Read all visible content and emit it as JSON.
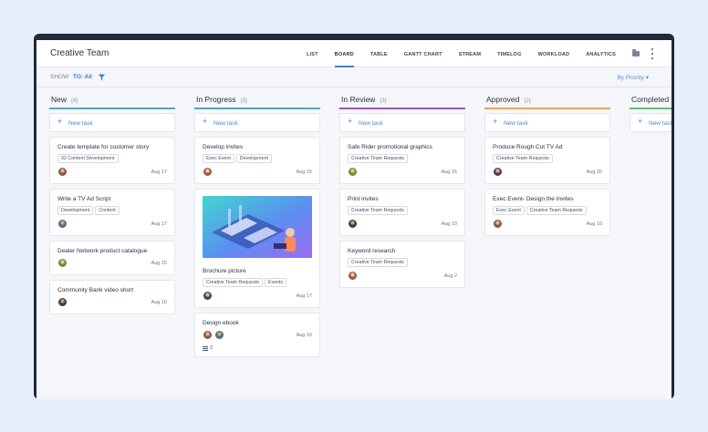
{
  "header": {
    "title": "Creative Team",
    "views": [
      "LIST",
      "BOARD",
      "TABLE",
      "GANTT CHART",
      "STREAM",
      "TIMELOG",
      "WORKLOAD",
      "ANALYTICS"
    ],
    "active_view": "BOARD"
  },
  "filter": {
    "show_label": "SHOW",
    "show_value": "TO: All",
    "sort_label": "By Priority ▾"
  },
  "new_task_label": "New task",
  "columns": [
    {
      "title": "New",
      "count": "(4)",
      "color": "#4aa3df",
      "cards": [
        {
          "title": "Create template for customer story",
          "tags": [
            "02 Content Development"
          ],
          "date": "Aug 17"
        },
        {
          "title": "Write a TV Ad Script",
          "tags": [
            "Development",
            "Content"
          ],
          "date": "Aug 17"
        },
        {
          "title": "Dealer Network product catalogue",
          "tags": [],
          "date": "Aug 15"
        },
        {
          "title": "Community Bank video short",
          "tags": [],
          "date": "Aug 10"
        }
      ]
    },
    {
      "title": "In Progress",
      "count": "(3)",
      "color": "#4aa3df",
      "cards": [
        {
          "title": "Develop invites",
          "tags": [
            "Exec Event",
            "Development"
          ],
          "date": "Aug 15"
        },
        {
          "title": "Brochure picture",
          "tags": [
            "Creative Team Requests",
            "Events"
          ],
          "date": "Aug 17"
        },
        {
          "title": "Design ebook",
          "tags": [],
          "date": "Aug 10",
          "subtasks": "2"
        }
      ]
    },
    {
      "title": "In Review",
      "count": "(3)",
      "color": "#9b4fd8",
      "cards": [
        {
          "title": "Safe Rider promotional graphics",
          "tags": [
            "Creative Team Requests"
          ],
          "date": "Aug 15"
        },
        {
          "title": "Print invites",
          "tags": [
            "Creative Team Requests"
          ],
          "date": "Aug 10"
        },
        {
          "title": "Keyword research",
          "tags": [
            "Creative Team Requests"
          ],
          "date": "Aug 2"
        }
      ]
    },
    {
      "title": "Approved",
      "count": "(2)",
      "color": "#f0a04b",
      "cards": [
        {
          "title": "Produce Rough Cut TV Ad",
          "tags": [
            "Creative Team Requests"
          ],
          "date": "Aug 20"
        },
        {
          "title": "Exec Event- Design the Invites",
          "tags": [
            "Exec Event",
            "Creative Team Requests"
          ],
          "date": "Aug 10"
        }
      ]
    },
    {
      "title": "Completed",
      "count": "",
      "color": "#5cc06b",
      "cards": []
    }
  ],
  "colors": {
    "accent": "#3b82d6",
    "new_column": "#4aa3df",
    "in_review": "#9b4fd8",
    "approved": "#f0a04b",
    "completed": "#5cc06b"
  }
}
